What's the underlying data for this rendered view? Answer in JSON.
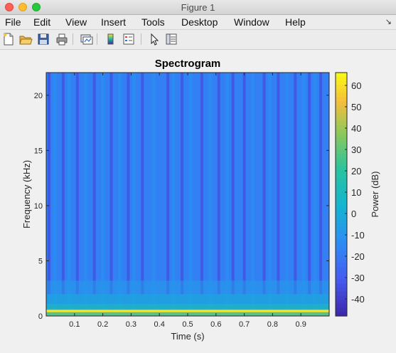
{
  "window": {
    "title": "Figure 1"
  },
  "menu": {
    "items": [
      "File",
      "Edit",
      "View",
      "Insert",
      "Tools",
      "Desktop",
      "Window",
      "Help"
    ],
    "overflow_arrow": "↘"
  },
  "toolbar": {
    "icons": [
      "new-figure-icon",
      "open-file-icon",
      "save-icon",
      "print-icon",
      "link-plot-icon",
      "insert-colorbar-icon",
      "insert-legend-icon",
      "edit-plot-icon",
      "property-inspector-icon"
    ]
  },
  "colors": {
    "axes_background": "#2f8fe8",
    "colormap": "parula"
  },
  "chart_data": {
    "type": "heatmap",
    "title": "Spectrogram",
    "xlabel": "Time (s)",
    "ylabel": "Frequency (kHz)",
    "xlim": [
      0.0,
      1.0
    ],
    "ylim": [
      0,
      22.05
    ],
    "xticks": [
      0.1,
      0.2,
      0.3,
      0.4,
      0.5,
      0.6,
      0.7,
      0.8,
      0.9
    ],
    "xtick_labels": [
      "0.1",
      "0.2",
      "0.3",
      "0.4",
      "0.5",
      "0.6",
      "0.7",
      "0.8",
      "0.9"
    ],
    "yticks": [
      0,
      5,
      10,
      15,
      20
    ],
    "ytick_labels": [
      "0",
      "5",
      "10",
      "15",
      "20"
    ],
    "colorbar": {
      "label": "Power (dB)",
      "clim": [
        -48,
        66
      ],
      "ticks": [
        60,
        50,
        40,
        30,
        20,
        10,
        0,
        -10,
        -20,
        -30,
        -40
      ],
      "tick_labels": [
        "60",
        "50",
        "40",
        "30",
        "20",
        "10",
        "0",
        "-10",
        "-20",
        "-30",
        "-40"
      ]
    },
    "background_power_db": -18,
    "low_band": [
      {
        "freq_khz": 0.45,
        "power_db": 62
      },
      {
        "freq_khz": 0.6,
        "power_db": 45
      },
      {
        "freq_khz": 0.3,
        "power_db": 25
      },
      {
        "freq_khz": 1.1,
        "power_db": 12
      },
      {
        "freq_khz": 2.0,
        "power_db": 0
      },
      {
        "freq_khz": 3.2,
        "power_db": -8
      }
    ],
    "dark_stripes_time_s": [
      0.01,
      0.06,
      0.11,
      0.17,
      0.23,
      0.29,
      0.34,
      0.43,
      0.48,
      0.55,
      0.61,
      0.66,
      0.7,
      0.77,
      0.82,
      0.88,
      0.93,
      0.97
    ],
    "dark_stripe_power_db": -35,
    "light_stripes_time_s": [
      0.03,
      0.08,
      0.14,
      0.2,
      0.26,
      0.31,
      0.38,
      0.45,
      0.51,
      0.58,
      0.64,
      0.73,
      0.79,
      0.85,
      0.91,
      0.95
    ],
    "light_stripe_power_db": -12
  }
}
